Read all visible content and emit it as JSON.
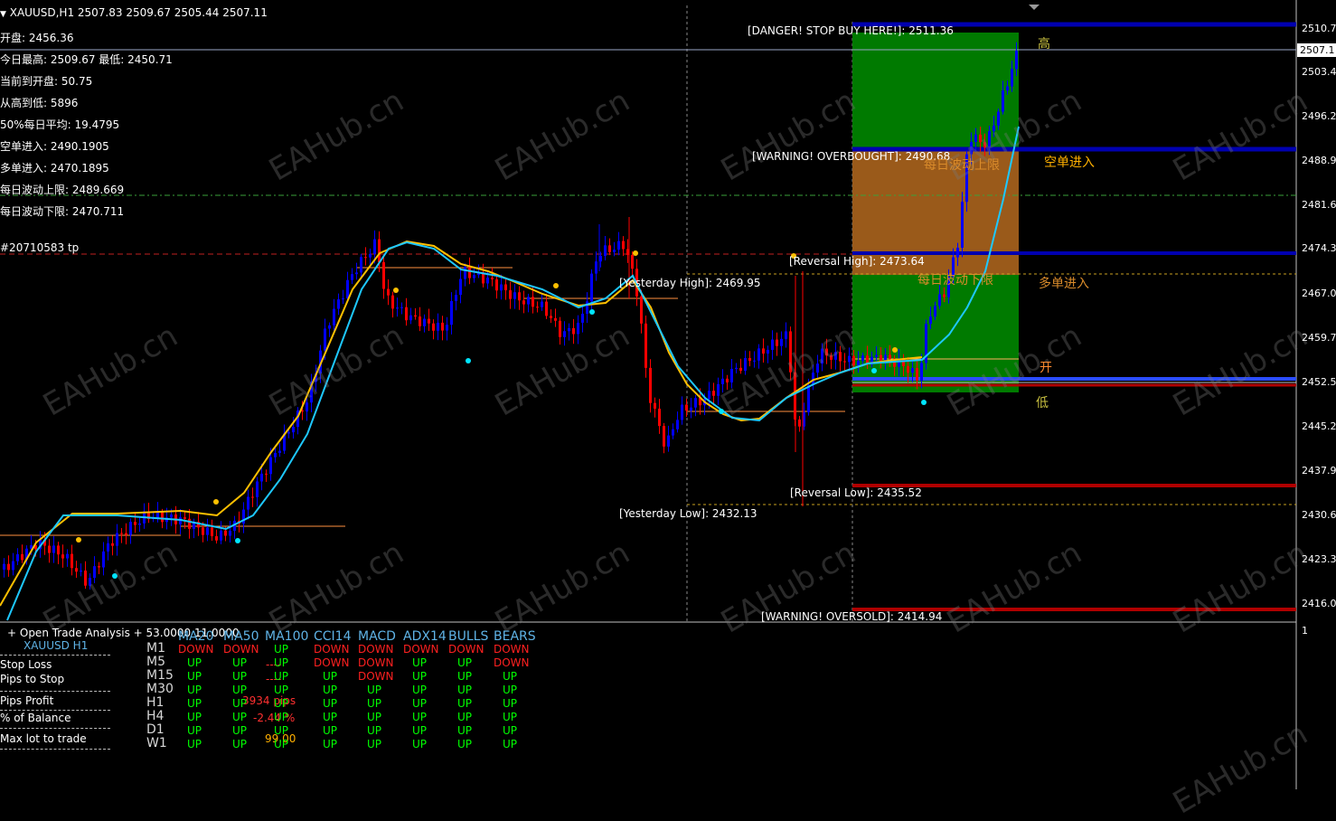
{
  "header": {
    "symbol_line": "XAUUSD,H1  2507.83 2509.67 2505.44 2507.11"
  },
  "info_lines": [
    "开盘: 2456.36",
    "今日最高: 2509.67  最低: 2450.71",
    "当前到开盘: 50.75",
    "从高到低: 5896",
    "50%每日平均: 19.4795",
    "空单进入: 2490.1905",
    "多单进入: 2470.1895",
    "每日波动上限: 2489.669",
    "每日波动下限: 2470.711"
  ],
  "order_label": "#20710583 tp",
  "chart_labels": {
    "danger": "[DANGER! STOP BUY HERE!]: 2511.36",
    "overbought": "[WARNING! OVERBOUGHT]: 2490.68",
    "reversal_high": "[Reversal High]: 2473.64",
    "yesterday_high": "[Yesterday High]: 2469.95",
    "reversal_low": "[Reversal Low]: 2435.52",
    "yesterday_low": "[Yesterday Low]: 2432.13",
    "oversold": "[WARNING! OVERSOLD]: 2414.94",
    "daily_upper": "每日波动上限",
    "daily_lower": "每日波动下限",
    "high": "高",
    "sell_entry": "空单进入",
    "buy_entry": "多单进入",
    "open": "开",
    "low": "低"
  },
  "price_axis": {
    "current": "2507.1",
    "ticks": [
      "2510.7",
      "2503.4",
      "2496.2",
      "2488.9",
      "2481.6",
      "2474.3",
      "2467.0",
      "2459.7",
      "2452.5",
      "2445.2",
      "2437.9",
      "2430.6",
      "2423.3",
      "2416.0"
    ]
  },
  "sub_axis_tick": "1",
  "panel": {
    "title": "+ Open Trade Analysis + 53.0000 11.0000",
    "symbol": "XAUUSD  H1",
    "stop_loss": "Stop Loss",
    "pips_to_stop": "Pips to Stop",
    "pips_profit": "Pips Profit",
    "pct_balance": "% of Balance",
    "max_lot": "Max lot to trade",
    "pips_profit_val": "3934 pips",
    "pct_balance_val": "-2.44 %",
    "max_lot_val": "99.00",
    "stop_dashes": "----"
  },
  "indicators": {
    "headers": [
      "MA20",
      "MA50",
      "MA100",
      "CCI14",
      "MACD",
      "ADX14",
      "BULLS",
      "BEARS"
    ],
    "timeframes": [
      "M1",
      "M5",
      "M15",
      "M30",
      "H1",
      "H4",
      "D1",
      "W1"
    ],
    "rows": [
      [
        "DOWN",
        "DOWN",
        "UP",
        "DOWN",
        "DOWN",
        "DOWN",
        "DOWN",
        "DOWN"
      ],
      [
        "UP",
        "UP",
        "UP",
        "DOWN",
        "DOWN",
        "UP",
        "UP",
        "DOWN"
      ],
      [
        "UP",
        "UP",
        "UP",
        "UP",
        "DOWN",
        "UP",
        "UP",
        "UP"
      ],
      [
        "UP",
        "UP",
        "UP",
        "UP",
        "UP",
        "UP",
        "UP",
        "UP"
      ],
      [
        "UP",
        "UP",
        "UP",
        "UP",
        "UP",
        "UP",
        "UP",
        "UP"
      ],
      [
        "UP",
        "UP",
        "UP",
        "UP",
        "UP",
        "UP",
        "UP",
        "UP"
      ],
      [
        "UP",
        "UP",
        "UP",
        "UP",
        "UP",
        "UP",
        "UP",
        "UP"
      ],
      [
        "UP",
        "UP",
        "UP",
        "UP",
        "UP",
        "UP",
        "UP",
        "UP"
      ]
    ]
  },
  "watermark": "EAHub.cn",
  "colors": {
    "bull": "#0000ff",
    "bear": "#ff0000",
    "ma_fast": "#ffc000",
    "ma_slow": "#1ec8ff",
    "zone_green": "#007a00",
    "zone_orange": "#9a5a1a"
  }
}
